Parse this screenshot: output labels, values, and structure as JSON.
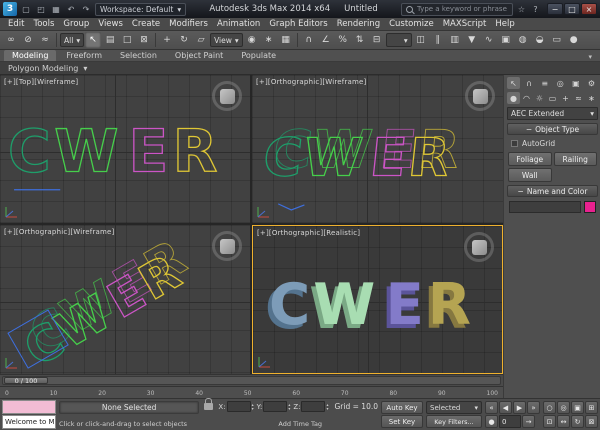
{
  "glyphs": {
    "dropdown": "▾",
    "collapse": "−",
    "minimize": "−",
    "maximize": "□",
    "close": "×",
    "star": "☆",
    "help": "?"
  },
  "titlebar": {
    "logo": "3",
    "quick_icons": [
      "▢",
      "◰",
      "▦",
      "↶",
      "↷"
    ],
    "workspace": "Workspace: Default",
    "app_title": "Autodesk 3ds Max 2014 x64",
    "doc_title": "Untitled",
    "search_placeholder": "Type a keyword or phrase"
  },
  "menubar": {
    "items": [
      "Edit",
      "Tools",
      "Group",
      "Views",
      "Create",
      "Modifiers",
      "Animation",
      "Graph Editors",
      "Rendering",
      "Customize",
      "MAXScript",
      "Help"
    ]
  },
  "toolbar": {
    "filter_value": "All",
    "coord_value": "View",
    "icons": [
      "∞",
      "⊘",
      "≈",
      "↖",
      "▤",
      "□",
      "⊠",
      "+",
      "↻",
      "▱",
      "◉",
      "∗",
      "▦",
      "∩",
      "∠",
      "%",
      "⇅",
      "⊟",
      "◫",
      "∥",
      "▥",
      "▼",
      "∿",
      "▣",
      "◍",
      "◒",
      "▭",
      "●"
    ]
  },
  "ribbon": {
    "tabs": [
      "Modeling",
      "Freeform",
      "Selection",
      "Object Paint",
      "Populate"
    ],
    "panel": "Polygon Modeling"
  },
  "viewports": {
    "labels": {
      "top_left": "[+][Top][Wireframe]",
      "top_right": "[+][Orthographic][Wireframe]",
      "bottom_left": "[+][Orthographic][Wireframe]",
      "bottom_right": "[+][Orthographic][Realistic]"
    },
    "scene_text": "CWER",
    "letters": [
      {
        "char": "C",
        "wire": "#1e9e6a",
        "solid": "#7d9cb8",
        "solid_dark": "#54738e"
      },
      {
        "char": "W",
        "wire": "#46cf4b",
        "solid": "#a8ddb2",
        "solid_dark": "#7aa985"
      },
      {
        "char": "E",
        "wire": "#cc55c6",
        "solid": "#837bc9",
        "solid_dark": "#5b549a"
      },
      {
        "char": "R",
        "wire": "#dfc735",
        "solid": "#b5a452",
        "solid_dark": "#867840"
      }
    ],
    "extra_wire": "#3e6fde"
  },
  "command_panel": {
    "tab_icons": [
      "↖",
      "∩",
      "≡",
      "◎",
      "▣",
      "⚙"
    ],
    "subtab_icons": [
      "●",
      "◠",
      "☼",
      "▭",
      "+",
      "≈",
      "∗"
    ],
    "category": "AEC Extended",
    "object_type_title": "Object Type",
    "autogrid_label": "AutoGrid",
    "buttons": [
      "Foliage",
      "Railing",
      "Wall"
    ],
    "name_color_title": "Name and Color",
    "color_swatch": "#e9218f"
  },
  "timeline": {
    "slider_label": "0 / 100",
    "ticks": [
      "0",
      "10",
      "20",
      "30",
      "40",
      "50",
      "60",
      "70",
      "80",
      "90",
      "100"
    ]
  },
  "status": {
    "listener": "Welcome to M",
    "selection": "None Selected",
    "prompt": "Click or click-and-drag to select objects",
    "coord_labels": [
      "X:",
      "Y:",
      "Z:"
    ],
    "grid": "Grid = 10.0",
    "time_tag": "Add Time Tag",
    "auto_key": "Auto Key",
    "set_key": "Set Key",
    "key_mode": "Selected",
    "key_filters": "Key Filters...",
    "frame": "0",
    "playback_row1": [
      "«",
      "◀",
      "▶",
      "»"
    ],
    "playback_key": "●",
    "playback_next": "→",
    "nav_icons": [
      "○",
      "◎",
      "▣",
      "⊞",
      "⊡",
      "↔",
      "↻",
      "⊠"
    ]
  }
}
